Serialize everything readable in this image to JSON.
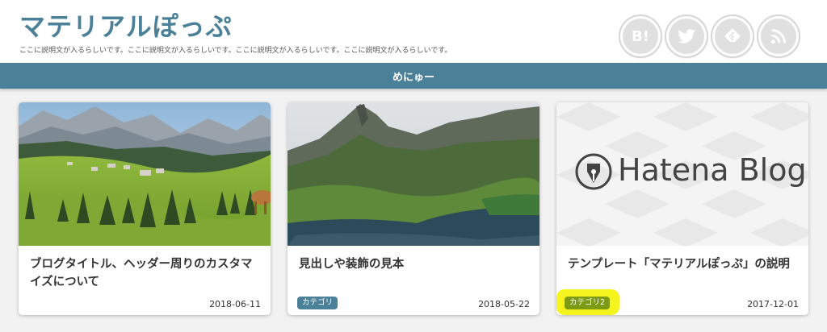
{
  "header": {
    "site_title": "マテリアルぽっぷ",
    "site_description": "ここに説明文が入るらしいです。ここに説明文が入るらしいです。ここに説明文が入るらしいです。ここに説明文が入るらしいです。",
    "social": [
      {
        "icon": "hatena-bookmark-icon",
        "label": "B!"
      },
      {
        "icon": "twitter-icon"
      },
      {
        "icon": "feedly-icon"
      },
      {
        "icon": "rss-icon"
      }
    ]
  },
  "nav": {
    "menu_label": "めにゅー"
  },
  "cards": [
    {
      "title": "ブログタイトル、ヘッダー周りのカスタマイズについて",
      "date": "2018-06-11",
      "category": ""
    },
    {
      "title": "見出しや装飾の見本",
      "date": "2018-05-22",
      "category": "カテゴリ"
    },
    {
      "title": "テンプレート「マテリアルぽっぷ」の説明",
      "date": "2017-12-01",
      "category": "カテゴリ2",
      "thumbnail_text": "Hatena Blog"
    }
  ],
  "colors": {
    "primary": "#4a8098",
    "category2": "#7d9a14",
    "highlight": "#f6f41e",
    "background": "#f2f2f2"
  }
}
